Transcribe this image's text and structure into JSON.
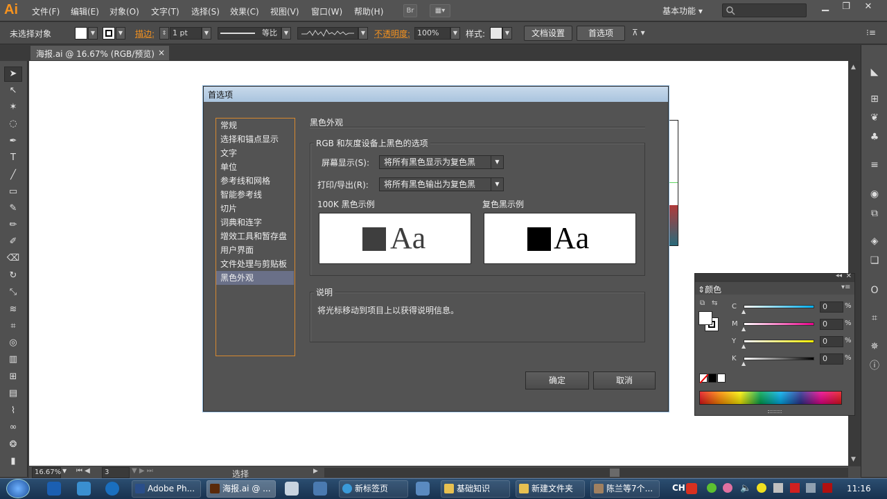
{
  "app": {
    "logo": "Ai"
  },
  "menu": [
    "文件(F)",
    "编辑(E)",
    "对象(O)",
    "文字(T)",
    "选择(S)",
    "效果(C)",
    "视图(V)",
    "窗口(W)",
    "帮助(H)"
  ],
  "menu_right": {
    "bridge": "Br",
    "workspace": "基本功能"
  },
  "control": {
    "selection": "未选择对象",
    "stroke_label": "描边:",
    "stroke_value": "1 pt",
    "stroke_profile": "等比",
    "opacity_label": "不透明度:",
    "opacity_value": "100%",
    "style_label": "样式:",
    "doc_setup": "文档设置",
    "prefs": "首选项"
  },
  "doc_tab": {
    "title": "海报.ai @ 16.67% (RGB/预览)",
    "close": "×"
  },
  "dialog": {
    "title": "首选项",
    "categories": [
      "常规",
      "选择和锚点显示",
      "文字",
      "单位",
      "参考线和网格",
      "智能参考线",
      "切片",
      "词典和连字",
      "增效工具和暂存盘",
      "用户界面",
      "文件处理与剪贴板",
      "黑色外观"
    ],
    "section_title": "黑色外观",
    "group_title": "RGB 和灰度设备上黑色的选项",
    "screen_label": "屏幕显示(S):",
    "screen_value": "将所有黑色显示为复色黑",
    "print_label": "打印/导出(R):",
    "print_value": "将所有黑色输出为复色黑",
    "sample1_label": "100K 黑色示例",
    "sample2_label": "复色黑示例",
    "sample_text": "Aa",
    "desc_title": "说明",
    "desc_text": "将光标移动到项目上以获得说明信息。",
    "ok": "确定",
    "cancel": "取消"
  },
  "color_panel": {
    "title": "颜色",
    "channels": [
      {
        "name": "C",
        "value": "0"
      },
      {
        "name": "M",
        "value": "0"
      },
      {
        "name": "Y",
        "value": "0"
      },
      {
        "name": "K",
        "value": "0"
      }
    ],
    "unit": "%"
  },
  "status": {
    "zoom": "16.67%",
    "page": "3",
    "tool": "选择"
  },
  "taskbar": {
    "items": [
      "Adobe Ph...",
      "海报.ai @ ...",
      "新标签页",
      "基础知识",
      "新建文件夹",
      "陈兰等7个..."
    ],
    "ime": "CH",
    "clock": "11:16"
  },
  "colors": {
    "accent": "#f7931e",
    "dialog_title": "#a9c4de",
    "selection": "#6a7088"
  }
}
